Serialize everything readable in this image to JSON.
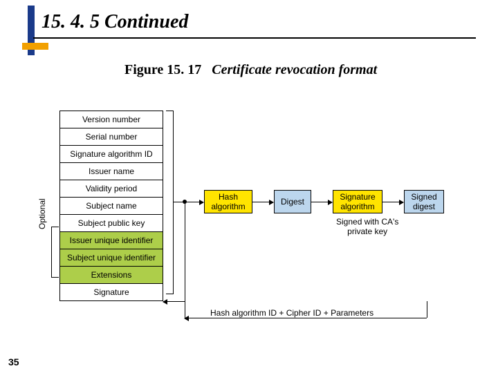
{
  "header": {
    "section": "15. 4. 5  Continued"
  },
  "figure": {
    "number": "Figure 15. 17",
    "title": "Certificate revocation format"
  },
  "page_number": "35",
  "stack": {
    "rows": [
      "Version number",
      "Serial number",
      "Signature algorithm ID",
      "Issuer name",
      "Validity period",
      "Subject name",
      "Subject public key",
      "Issuer unique identifier",
      "Subject unique identifier",
      "Extensions",
      "Signature"
    ],
    "optional_indices": [
      7,
      8,
      9
    ],
    "optional_label": "Optional"
  },
  "flow": {
    "hash_alg": "Hash\nalgorithm",
    "digest": "Digest",
    "sig_alg": "Signature\nalgorithm",
    "signed_digest": "Signed\ndigest",
    "sign_note": "Signed with CA's\nprivate key",
    "feedback": "Hash algorithm ID + Cipher ID + Parameters"
  }
}
